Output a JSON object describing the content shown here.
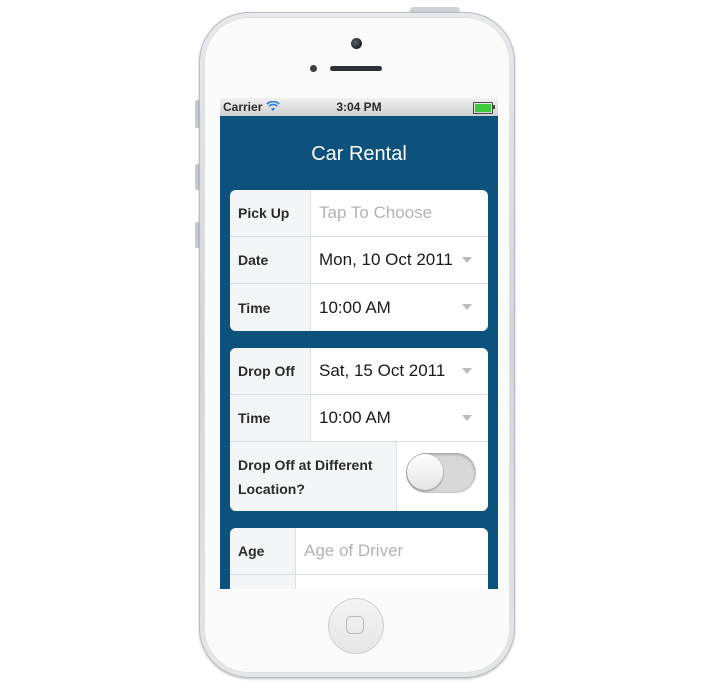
{
  "status_bar": {
    "carrier": "Carrier",
    "time": "3:04 PM"
  },
  "nav": {
    "title": "Car Rental"
  },
  "pickup_card": {
    "pickup_label": "Pick Up",
    "pickup_placeholder": "Tap To Choose",
    "date_label": "Date",
    "date_value": "Mon, 10 Oct 2011",
    "time_label": "Time",
    "time_value": "10:00 AM"
  },
  "dropoff_card": {
    "dropoff_label": "Drop Off",
    "dropoff_value": "Sat, 15 Oct 2011",
    "time_label": "Time",
    "time_value": "10:00 AM",
    "different_location_label_line1": "Drop Off at Different",
    "different_location_label_line2": "Location?",
    "different_location_on": false
  },
  "driver_card": {
    "age_label": "Age",
    "age_placeholder": "Age of Driver"
  },
  "colors": {
    "nav_background": "#0c527c",
    "battery": "#3fc93c"
  }
}
